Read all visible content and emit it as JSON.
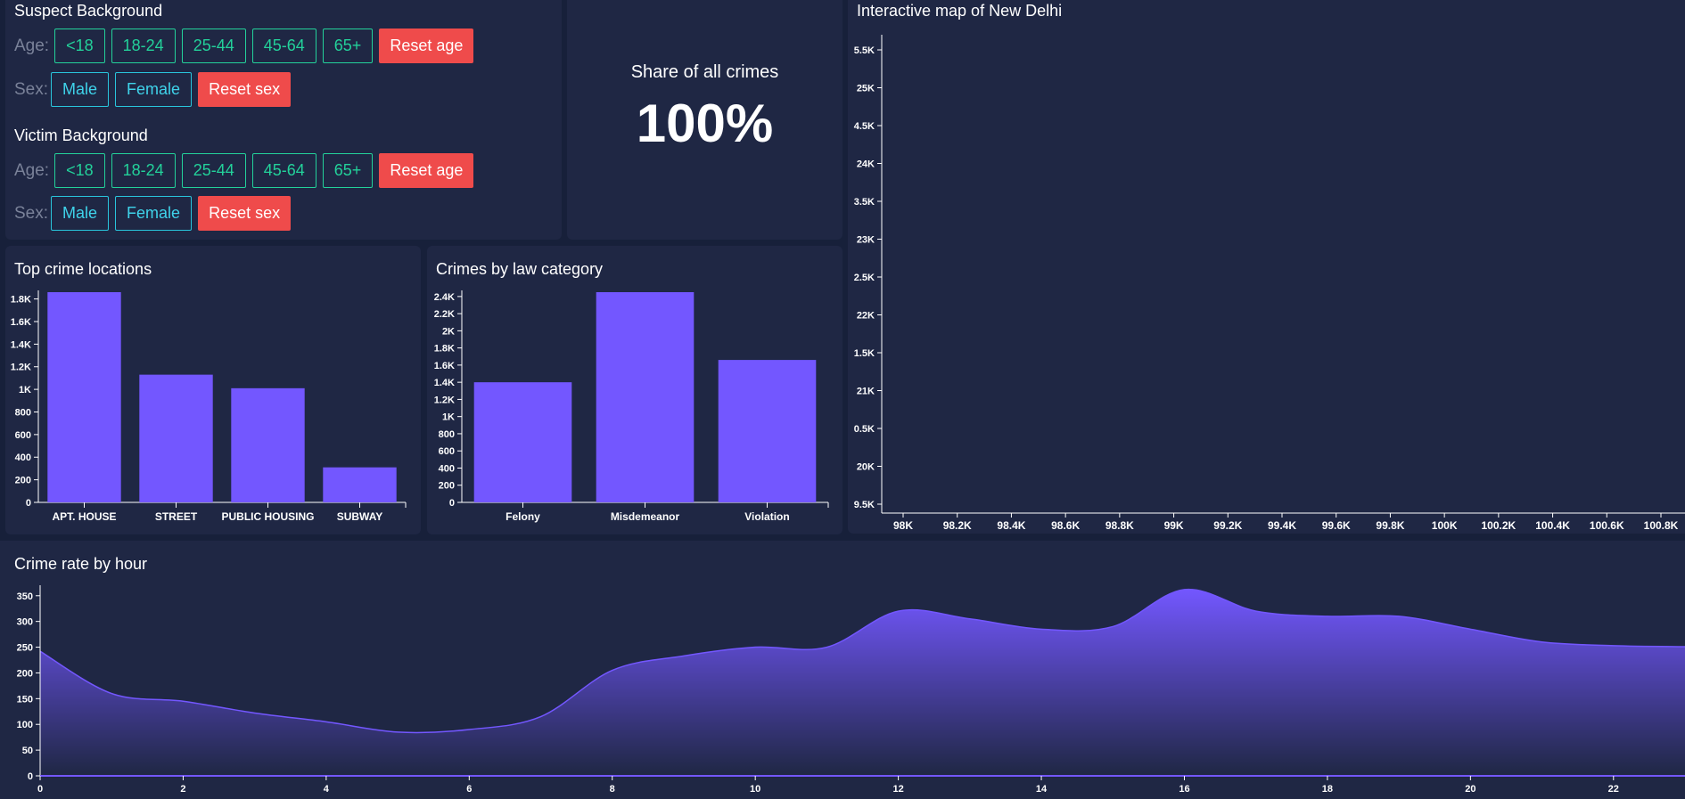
{
  "suspect": {
    "title": "Suspect Background",
    "age_label": "Age:",
    "age_buttons": [
      "<18",
      "18-24",
      "25-44",
      "45-64",
      "65+"
    ],
    "reset_age": "Reset age",
    "sex_label": "Sex:",
    "sex_buttons": [
      "Male",
      "Female"
    ],
    "reset_sex": "Reset sex"
  },
  "victim": {
    "title": "Victim Background",
    "age_label": "Age:",
    "age_buttons": [
      "<18",
      "18-24",
      "25-44",
      "45-64",
      "65+"
    ],
    "reset_age": "Reset age",
    "sex_label": "Sex:",
    "sex_buttons": [
      "Male",
      "Female"
    ],
    "reset_sex": "Reset sex"
  },
  "share": {
    "label": "Share of all crimes",
    "value": "100%"
  },
  "map": {
    "title": "Interactive map of New Delhi"
  },
  "locations": {
    "title": "Top crime locations"
  },
  "law": {
    "title": "Crimes by law category"
  },
  "hourly": {
    "title": "Crime rate by hour"
  },
  "colors": {
    "background": "#17203a",
    "panel": "#1f2744",
    "bar": "#7357ff",
    "age_button": "#23d19a",
    "sex_button": "#29c5dc",
    "reset_button": "#ef4b4b"
  },
  "chart_data": [
    {
      "type": "bar",
      "title": "Top crime locations",
      "categories": [
        "APT. HOUSE",
        "STREET",
        "PUBLIC HOUSING",
        "SUBWAY"
      ],
      "values": [
        1860,
        1130,
        1010,
        310
      ],
      "ylim": [
        0,
        1860
      ],
      "yticks": [
        0,
        200,
        400,
        600,
        800,
        1000,
        1200,
        1400,
        1600,
        1800
      ],
      "ytick_labels": [
        "0",
        "200",
        "400",
        "600",
        "800",
        "1K",
        "1.2K",
        "1.4K",
        "1.6K",
        "1.8K"
      ]
    },
    {
      "type": "bar",
      "title": "Crimes by law category",
      "categories": [
        "Felony",
        "Misdemeanor",
        "Violation"
      ],
      "values": [
        1400,
        2450,
        1660
      ],
      "ylim": [
        0,
        2450
      ],
      "yticks": [
        0,
        200,
        400,
        600,
        800,
        1000,
        1200,
        1400,
        1600,
        1800,
        2000,
        2200,
        2400
      ],
      "ytick_labels": [
        "0",
        "200",
        "400",
        "600",
        "800",
        "1K",
        "1.2K",
        "1.4K",
        "1.6K",
        "1.8K",
        "2K",
        "2.2K",
        "2.4K"
      ]
    },
    {
      "type": "scatter",
      "title": "Interactive map of New Delhi",
      "x": [],
      "y": [],
      "xtick_labels": [
        "98K",
        "98.2K",
        "98.4K",
        "98.6K",
        "98.8K",
        "99K",
        "99.2K",
        "99.4K",
        "99.6K",
        "99.8K",
        "100K",
        "100.2K",
        "100.4K",
        "100.6K",
        "100.8K"
      ],
      "ytick_labels": [
        "5.5K",
        "25K",
        "4.5K",
        "24K",
        "3.5K",
        "23K",
        "2.5K",
        "22K",
        "1.5K",
        "21K",
        "0.5K",
        "20K",
        "9.5K"
      ]
    },
    {
      "type": "area",
      "title": "Crime rate by hour",
      "x": [
        0,
        1,
        2,
        3,
        4,
        5,
        6,
        7,
        8,
        9,
        10,
        11,
        12,
        13,
        14,
        15,
        16,
        17,
        18,
        19,
        20,
        21,
        22,
        23
      ],
      "values": [
        242,
        160,
        145,
        122,
        105,
        85,
        90,
        115,
        205,
        233,
        250,
        250,
        320,
        305,
        285,
        290,
        362,
        320,
        310,
        310,
        285,
        260,
        253,
        251
      ],
      "ylim": [
        0,
        360
      ],
      "yticks": [
        0,
        50,
        100,
        150,
        200,
        250,
        300,
        350
      ],
      "xticks": [
        0,
        2,
        4,
        6,
        8,
        10,
        12,
        14,
        16,
        18,
        20,
        22
      ]
    }
  ]
}
